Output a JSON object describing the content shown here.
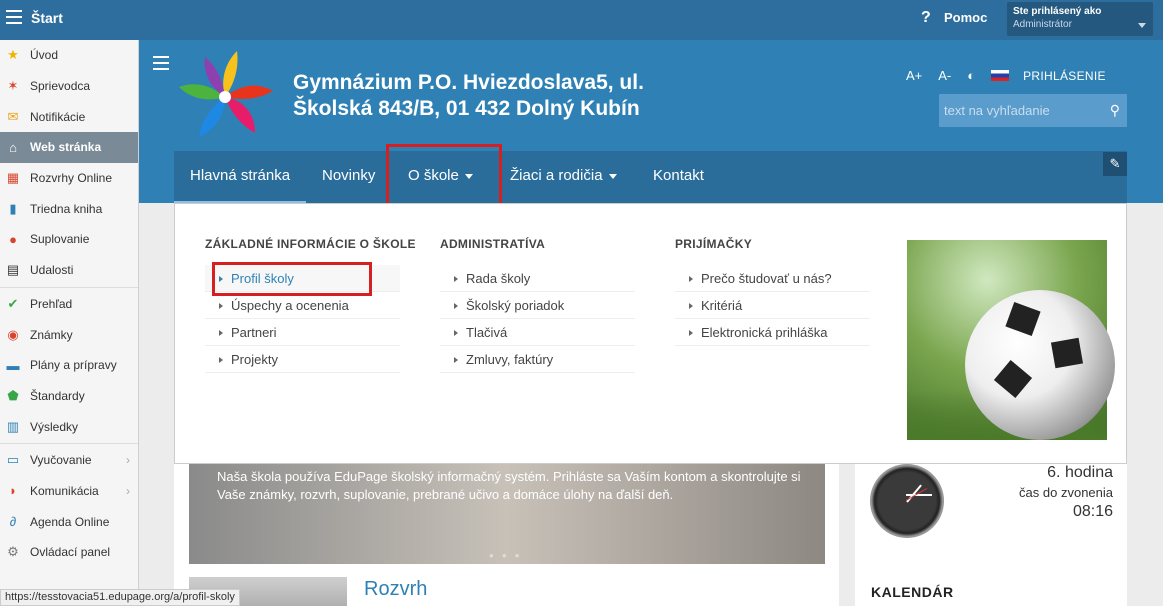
{
  "topbar": {
    "title": "Štart",
    "help": "Pomoc",
    "user_line1": "Ste prihlásený ako",
    "user_line2": "Administrátor"
  },
  "sidebar": {
    "items": [
      {
        "label": "Úvod",
        "icon": "star-icon"
      },
      {
        "label": "Sprievodca",
        "icon": "wand-icon"
      },
      {
        "label": "Notifikácie",
        "icon": "envelope-icon"
      },
      {
        "label": "Web stránka",
        "icon": "house-icon"
      },
      {
        "label": "Rozvrhy Online",
        "icon": "calendar-grid-icon"
      },
      {
        "label": "Triedna kniha",
        "icon": "book-icon"
      },
      {
        "label": "Suplovanie",
        "icon": "person-icon"
      },
      {
        "label": "Udalosti",
        "icon": "calendar-icon"
      },
      {
        "label": "Prehľad",
        "icon": "check-circle-icon"
      },
      {
        "label": "Známky",
        "icon": "grade-icon"
      },
      {
        "label": "Plány a prípravy",
        "icon": "briefcase-icon"
      },
      {
        "label": "Štandardy",
        "icon": "shield-icon"
      },
      {
        "label": "Výsledky",
        "icon": "bar-chart-icon"
      },
      {
        "label": "Vyučovanie",
        "icon": "book-open-icon"
      },
      {
        "label": "Komunikácia",
        "icon": "chat-icon"
      },
      {
        "label": "Agenda Online",
        "icon": "paperclip-icon"
      },
      {
        "label": "Ovládací panel",
        "icon": "gear-icon"
      }
    ]
  },
  "site": {
    "school_line1": "Gymnázium P.O. Hviezdoslava5, ul.",
    "school_line2": "Školská 843/B, 01 432 Dolný Kubín",
    "font_plus": "A+",
    "font_minus": "A-",
    "login": "PRIHLÁSENIE",
    "search_placeholder": "text na vyhľadanie",
    "nav": [
      "Hlavná stránka",
      "Novinky",
      "O škole",
      "Žiaci a rodičia",
      "Kontakt"
    ],
    "menu": {
      "col1": {
        "title": "ZÁKLADNÉ INFORMÁCIE O ŠKOLE",
        "items": [
          "Profil školy",
          "Úspechy a ocenenia",
          "Partneri",
          "Projekty"
        ]
      },
      "col2": {
        "title": "ADMINISTRATÍVA",
        "items": [
          "Rada školy",
          "Školský poriadok",
          "Tlačivá",
          "Zmluvy, faktúry"
        ]
      },
      "col3": {
        "title": "PRIJÍMAČKY",
        "items": [
          "Prečo študovať u nás?",
          "Kritériá",
          "Elektronická prihláška"
        ]
      }
    },
    "hero_caption": "Naša škola používa EduPage školský informačný systém. Prihláste sa Vaším kontom a skontrolujte si Vaše známky, rozvrh, suplovanie, prebrané učivo a domáce úlohy na ďalší deň.",
    "lesson": "6. hodina",
    "lesson_sub": "čas do zvonenia",
    "lesson_time": "08:16",
    "rozvrh": "Rozvrh",
    "kalendar": "KALENDÁR"
  },
  "status_url": "https://tesstovacia51.edupage.org/a/profil-skoly",
  "colors": {
    "topbar": "#2e6e9e",
    "banner": "#2f81b5",
    "nav": "#2a6d9b",
    "highlight": "#d42020"
  }
}
